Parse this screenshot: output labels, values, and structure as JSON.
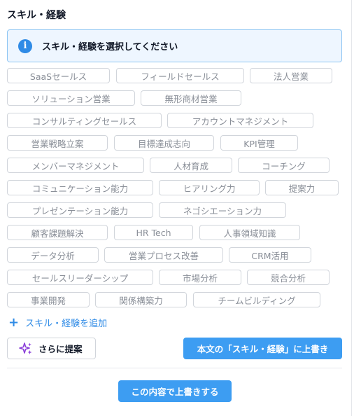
{
  "section": {
    "title": "スキル・経験"
  },
  "info": {
    "message": "スキル・経験を選択してください",
    "icon": "info-icon"
  },
  "tags": [
    "SaaSセールス",
    "フィールドセールス",
    "法人営業",
    "ソリューション営業",
    "無形商材営業",
    "コンサルティングセールス",
    "アカウントマネジメント",
    "営業戦略立案",
    "目標達成志向",
    "KPI管理",
    "メンバーマネジメント",
    "人材育成",
    "コーチング",
    "コミュニケーション能力",
    "ヒアリング力",
    "提案力",
    "プレゼンテーション能力",
    "ネゴシエーション力",
    "顧客課題解決",
    "HR Tech",
    "人事領域知識",
    "データ分析",
    "営業プロセス改善",
    "CRM活用",
    "セールスリーダーシップ",
    "市場分析",
    "競合分析",
    "事業開発",
    "関係構築力",
    "チームビルディング"
  ],
  "actions": {
    "add_label": "スキル・経験を追加",
    "suggest_label": "さらに提案",
    "overwrite_label": "本文の「スキル・経験」に上書き",
    "apply_label": "この内容で上書きする"
  },
  "colors": {
    "accent": "#3d9df2",
    "info_bg": "#eef6ff",
    "info_border": "#8ec5f3",
    "sparkle": "#8b3fd9"
  }
}
